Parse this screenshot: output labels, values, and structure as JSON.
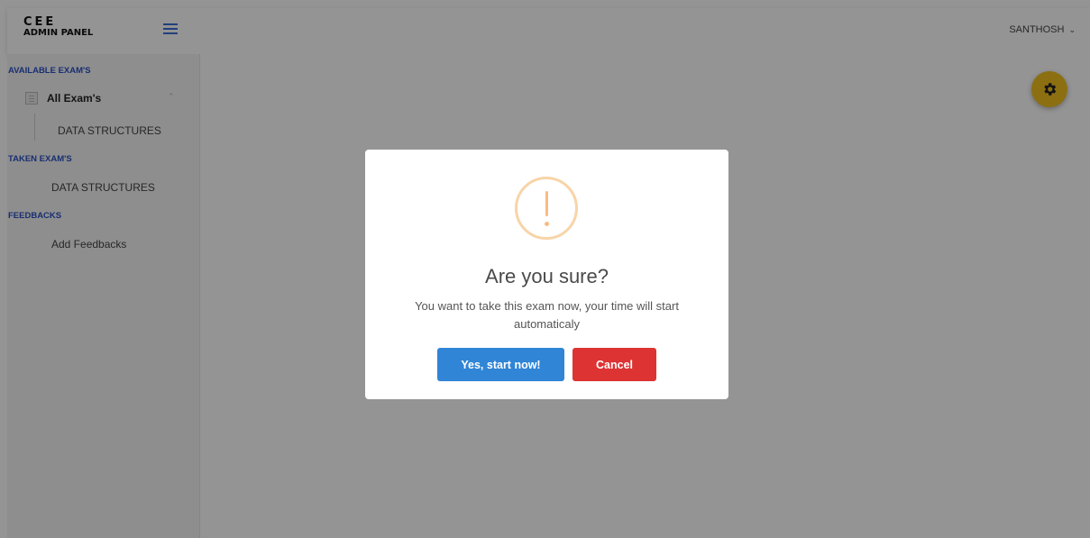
{
  "header": {
    "logo_line1": "CEE",
    "logo_line2": "ADMIN PANEL",
    "user_name": "SANTHOSH"
  },
  "sidebar": {
    "sections": [
      {
        "title": "AVAILABLE EXAM'S",
        "parent": "All Exam's",
        "items": [
          "DATA STRUCTURES"
        ]
      },
      {
        "title": "TAKEN EXAM'S",
        "items": [
          "DATA STRUCTURES"
        ]
      },
      {
        "title": "FEEDBACKS",
        "items": [
          "Add Feedbacks"
        ]
      }
    ]
  },
  "modal": {
    "icon": "warning-icon",
    "title": "Are you sure?",
    "text": "You want to take this exam now, your time will start automaticaly",
    "confirm_label": "Yes, start now!",
    "cancel_label": "Cancel"
  },
  "colors": {
    "accent_blue": "#2b50c4",
    "confirm_button": "#3085d6",
    "cancel_button": "#dd3333",
    "settings_button": "#f2c01e",
    "warning_icon": "#f8bb86"
  },
  "icons": {
    "menu": "hamburger-icon",
    "user_dropdown": "chevron-down-icon",
    "settings": "gear-icon",
    "exam_list": "document-icon",
    "collapse": "chevron-up-icon"
  }
}
